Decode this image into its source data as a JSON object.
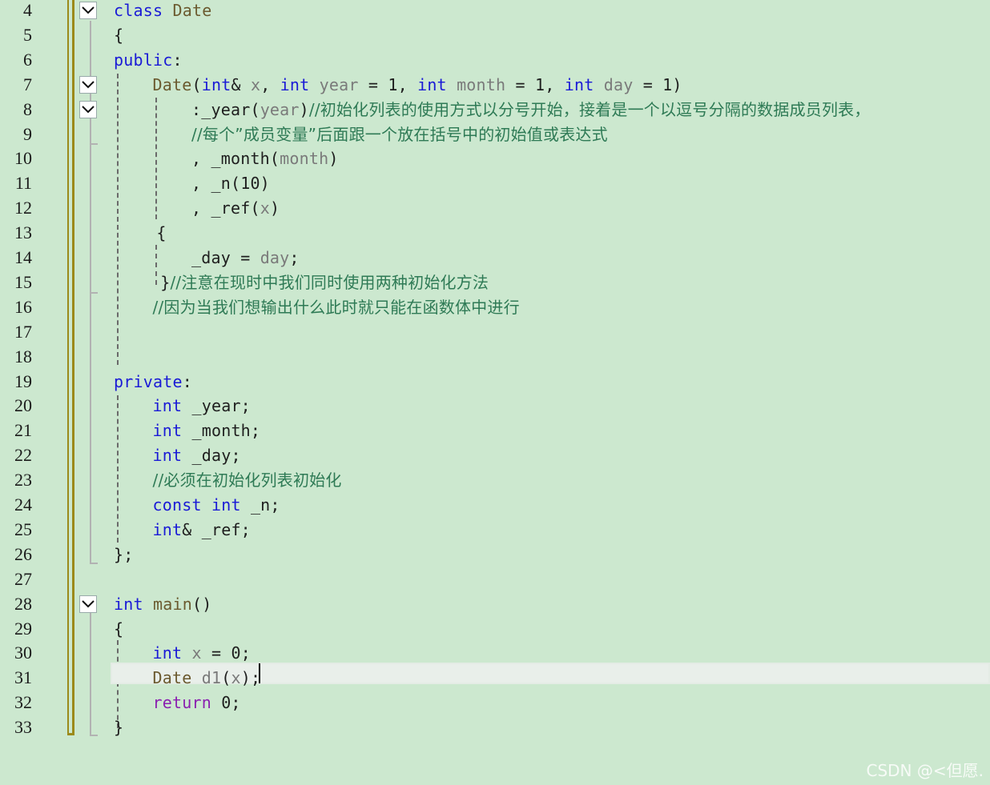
{
  "editor": {
    "lines": [
      {
        "n": "4",
        "indent": 0,
        "fold": true,
        "tokens": [
          {
            "c": "kw",
            "t": "class"
          },
          {
            "c": "pn",
            "t": " "
          },
          {
            "c": "ty",
            "t": "Date"
          }
        ]
      },
      {
        "n": "5",
        "indent": 0,
        "tokens": [
          {
            "c": "pn",
            "t": "{"
          }
        ]
      },
      {
        "n": "6",
        "indent": 0,
        "tokens": [
          {
            "c": "kw",
            "t": "public"
          },
          {
            "c": "pn",
            "t": ":"
          }
        ]
      },
      {
        "n": "7",
        "indent": 1,
        "fold": true,
        "tokens": [
          {
            "c": "fn",
            "t": "Date"
          },
          {
            "c": "pn",
            "t": "("
          },
          {
            "c": "kw",
            "t": "int"
          },
          {
            "c": "pn",
            "t": "& "
          },
          {
            "c": "pm",
            "t": "x"
          },
          {
            "c": "pn",
            "t": ", "
          },
          {
            "c": "kw",
            "t": "int"
          },
          {
            "c": "pn",
            "t": " "
          },
          {
            "c": "pm",
            "t": "year"
          },
          {
            "c": "pn",
            "t": " = 1, "
          },
          {
            "c": "kw",
            "t": "int"
          },
          {
            "c": "pn",
            "t": " "
          },
          {
            "c": "pm",
            "t": "month"
          },
          {
            "c": "pn",
            "t": " = 1, "
          },
          {
            "c": "kw",
            "t": "int"
          },
          {
            "c": "pn",
            "t": " "
          },
          {
            "c": "pm",
            "t": "day"
          },
          {
            "c": "pn",
            "t": " = 1)"
          }
        ]
      },
      {
        "n": "8",
        "indent": 2,
        "fold": true,
        "tokens": [
          {
            "c": "pn",
            "t": ":_year("
          },
          {
            "c": "pm",
            "t": "year"
          },
          {
            "c": "pn",
            "t": ")"
          },
          {
            "c": "cm",
            "t": "//初始化列表的使用方式以分号开始，接着是一个以逗号分隔的数据成员列表，"
          }
        ]
      },
      {
        "n": "9",
        "indent": 2,
        "tokens": [
          {
            "c": "cm",
            "t": "//每个”成员变量”后面跟一个放在括号中的初始值或表达式"
          }
        ]
      },
      {
        "n": "10",
        "indent": 2,
        "tokens": [
          {
            "c": "pn",
            "t": ", _month("
          },
          {
            "c": "pm",
            "t": "month"
          },
          {
            "c": "pn",
            "t": ")"
          }
        ]
      },
      {
        "n": "11",
        "indent": 2,
        "tokens": [
          {
            "c": "pn",
            "t": ", _n(10)"
          }
        ]
      },
      {
        "n": "12",
        "indent": 2,
        "tokens": [
          {
            "c": "pn",
            "t": ", _ref("
          },
          {
            "c": "pm",
            "t": "x"
          },
          {
            "c": "pn",
            "t": ")"
          }
        ]
      },
      {
        "n": "13",
        "indent": 1.1,
        "tokens": [
          {
            "c": "pn",
            "t": "{"
          }
        ]
      },
      {
        "n": "14",
        "indent": 2,
        "tokens": [
          {
            "c": "pn",
            "t": "_day = "
          },
          {
            "c": "pm",
            "t": "day"
          },
          {
            "c": "pn",
            "t": ";"
          }
        ]
      },
      {
        "n": "15",
        "indent": 1.2,
        "tokens": [
          {
            "c": "pn",
            "t": "}"
          },
          {
            "c": "cm",
            "t": "//注意在现时中我们同时使用两种初始化方法"
          }
        ]
      },
      {
        "n": "16",
        "indent": 1,
        "tokens": [
          {
            "c": "cm",
            "t": "//因为当我们想输出什么此时就只能在函数体中进行"
          }
        ]
      },
      {
        "n": "17",
        "indent": 0,
        "tokens": []
      },
      {
        "n": "18",
        "indent": 0,
        "tokens": []
      },
      {
        "n": "19",
        "indent": 0,
        "tokens": [
          {
            "c": "kw",
            "t": "private"
          },
          {
            "c": "pn",
            "t": ":"
          }
        ]
      },
      {
        "n": "20",
        "indent": 1,
        "tokens": [
          {
            "c": "kw",
            "t": "int"
          },
          {
            "c": "pn",
            "t": " _year;"
          }
        ]
      },
      {
        "n": "21",
        "indent": 1,
        "tokens": [
          {
            "c": "kw",
            "t": "int"
          },
          {
            "c": "pn",
            "t": " _month;"
          }
        ]
      },
      {
        "n": "22",
        "indent": 1,
        "tokens": [
          {
            "c": "kw",
            "t": "int"
          },
          {
            "c": "pn",
            "t": " _day;"
          }
        ]
      },
      {
        "n": "23",
        "indent": 1,
        "tokens": [
          {
            "c": "cm",
            "t": "//必须在初始化列表初始化"
          }
        ]
      },
      {
        "n": "24",
        "indent": 1,
        "tokens": [
          {
            "c": "kw",
            "t": "const"
          },
          {
            "c": "pn",
            "t": " "
          },
          {
            "c": "kw",
            "t": "int"
          },
          {
            "c": "pn",
            "t": " _n;"
          }
        ]
      },
      {
        "n": "25",
        "indent": 1,
        "tokens": [
          {
            "c": "kw",
            "t": "int"
          },
          {
            "c": "pn",
            "t": "& _ref;"
          }
        ]
      },
      {
        "n": "26",
        "indent": 0,
        "tokens": [
          {
            "c": "pn",
            "t": "};"
          }
        ]
      },
      {
        "n": "27",
        "indent": 0,
        "tokens": []
      },
      {
        "n": "28",
        "indent": 0,
        "fold": true,
        "tokens": [
          {
            "c": "kw",
            "t": "int"
          },
          {
            "c": "pn",
            "t": " "
          },
          {
            "c": "fn",
            "t": "main"
          },
          {
            "c": "pn",
            "t": "()"
          }
        ]
      },
      {
        "n": "29",
        "indent": 0,
        "tokens": [
          {
            "c": "pn",
            "t": "{"
          }
        ]
      },
      {
        "n": "30",
        "indent": 1,
        "tokens": [
          {
            "c": "kw",
            "t": "int"
          },
          {
            "c": "pn",
            "t": " "
          },
          {
            "c": "pm",
            "t": "x"
          },
          {
            "c": "pn",
            "t": " = 0;"
          }
        ]
      },
      {
        "n": "31",
        "indent": 1,
        "tokens": [
          {
            "c": "ty",
            "t": "Date"
          },
          {
            "c": "pn",
            "t": " "
          },
          {
            "c": "pm",
            "t": "d1"
          },
          {
            "c": "pn",
            "t": "("
          },
          {
            "c": "pm",
            "t": "x"
          },
          {
            "c": "pn",
            "t": ");"
          }
        ]
      },
      {
        "n": "32",
        "indent": 1,
        "tokens": [
          {
            "c": "kp",
            "t": "return"
          },
          {
            "c": "pn",
            "t": " 0;"
          }
        ]
      },
      {
        "n": "33",
        "indent": 0,
        "tokens": [
          {
            "c": "pn",
            "t": "}"
          }
        ]
      }
    ],
    "current_line": "31"
  },
  "watermark": "CSDN @<但愿."
}
